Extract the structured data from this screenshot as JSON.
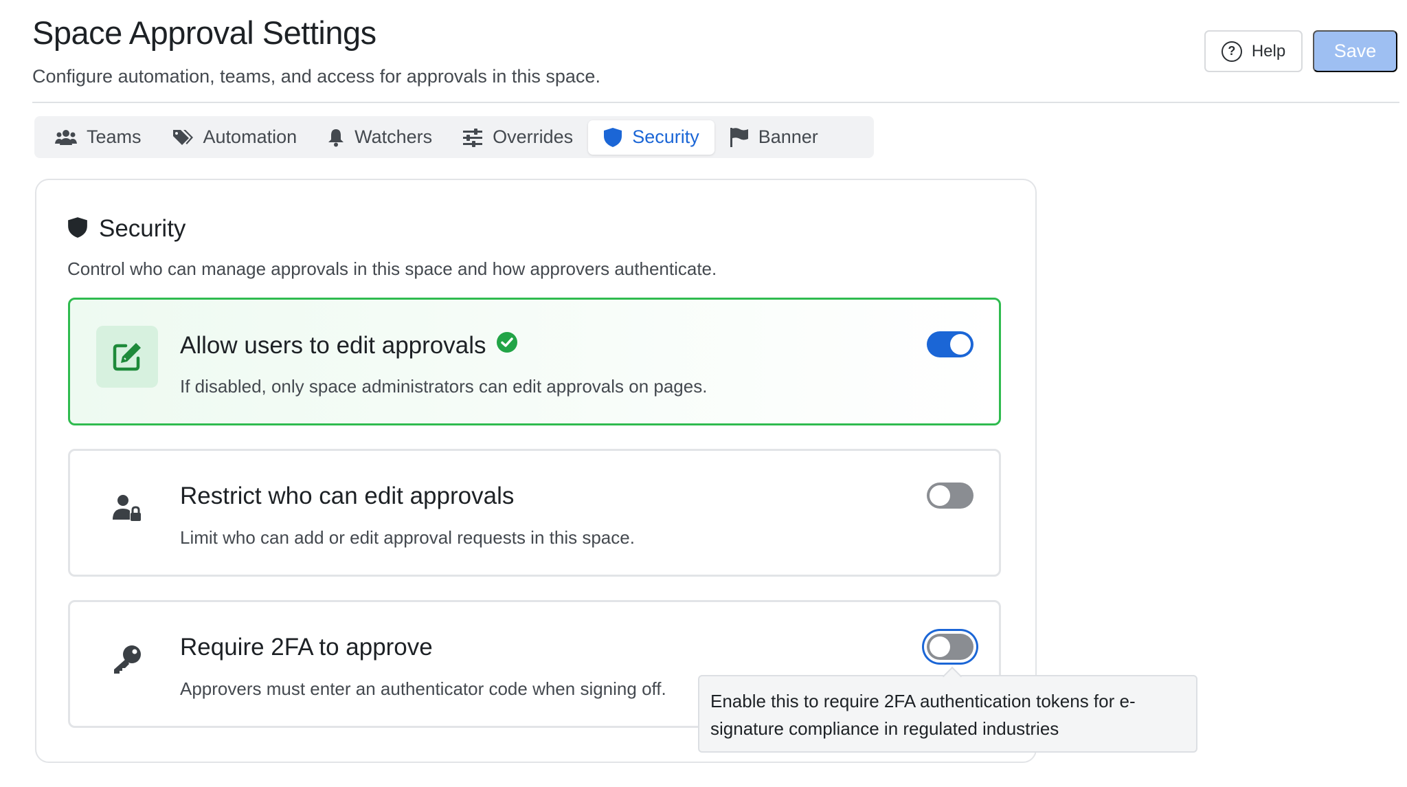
{
  "header": {
    "title": "Space Approval Settings",
    "subtitle": "Configure automation, teams, and access for approvals in this space.",
    "help_label": "Help",
    "save_label": "Save"
  },
  "tabs": [
    {
      "label": "Teams",
      "icon": "users-icon"
    },
    {
      "label": "Automation",
      "icon": "tags-icon"
    },
    {
      "label": "Watchers",
      "icon": "bell-icon"
    },
    {
      "label": "Overrides",
      "icon": "sliders-icon"
    },
    {
      "label": "Security",
      "icon": "shield-icon",
      "active": true
    },
    {
      "label": "Banner",
      "icon": "flag-icon"
    }
  ],
  "security": {
    "title": "Security",
    "description": "Control who can manage approvals in this space and how approvers authenticate.",
    "settings": [
      {
        "title": "Allow users to edit approvals",
        "description": "If disabled, only space administrators can edit approvals on pages.",
        "enabled": true,
        "icon": "edit-icon",
        "verified": true
      },
      {
        "title": "Restrict who can edit approvals",
        "description": "Limit who can add or edit approval requests in this space.",
        "enabled": false,
        "icon": "user-lock-icon"
      },
      {
        "title": "Require 2FA to approve",
        "description": "Approvers must enter an authenticator code when signing off.",
        "enabled": false,
        "icon": "key-icon"
      }
    ]
  },
  "tooltip": {
    "text": "Enable this to require 2FA authentication tokens for e-signature compliance in regulated industries"
  },
  "colors": {
    "accent": "#1b66d6",
    "success": "#2fbb4f",
    "save_disabled": "#9ebff2"
  }
}
